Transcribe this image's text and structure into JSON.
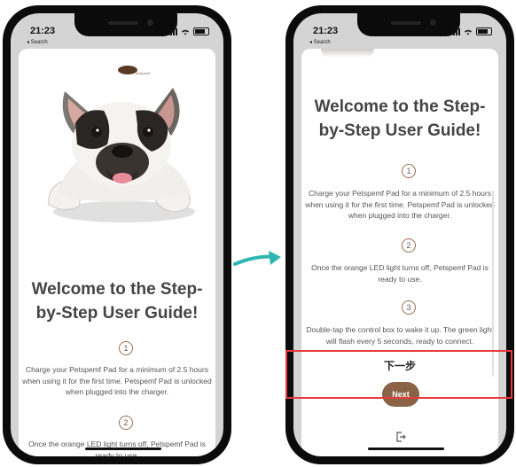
{
  "status": {
    "time": "21:23",
    "back_label": "◂ Search"
  },
  "left_screen": {
    "logo_text": "petspemf",
    "welcome_title": "Welcome to the Step-by-Step User Guide!",
    "steps": [
      {
        "number": "1",
        "text": "Charge your Petspemf Pad for a minimum of 2.5 hours when using it for the first time. Petspemf Pad is unlocked when plugged into the charger."
      },
      {
        "number": "2",
        "text": "Once the orange LED light turns off, Petspemf Pad is ready to use."
      }
    ]
  },
  "right_screen": {
    "welcome_title": "Welcome to the Step-by-Step User Guide!",
    "steps": [
      {
        "number": "1",
        "text": "Charge your Petspemf Pad for a minimum of 2.5 hours when using it for the first time. Petspemf Pad is unlocked when plugged into the charger."
      },
      {
        "number": "2",
        "text": "Once the orange LED light turns off, Petspemf Pad is ready to use."
      },
      {
        "number": "3",
        "text": "Double-tap the control box to wake it up. The green light will flash every 5 seconds, ready to connect."
      }
    ],
    "next_label_zh": "下一步",
    "next_button": "Next"
  },
  "colors": {
    "accent": "#8a6246",
    "arrow": "#2fb6b0",
    "highlight": "#e63a3a"
  }
}
